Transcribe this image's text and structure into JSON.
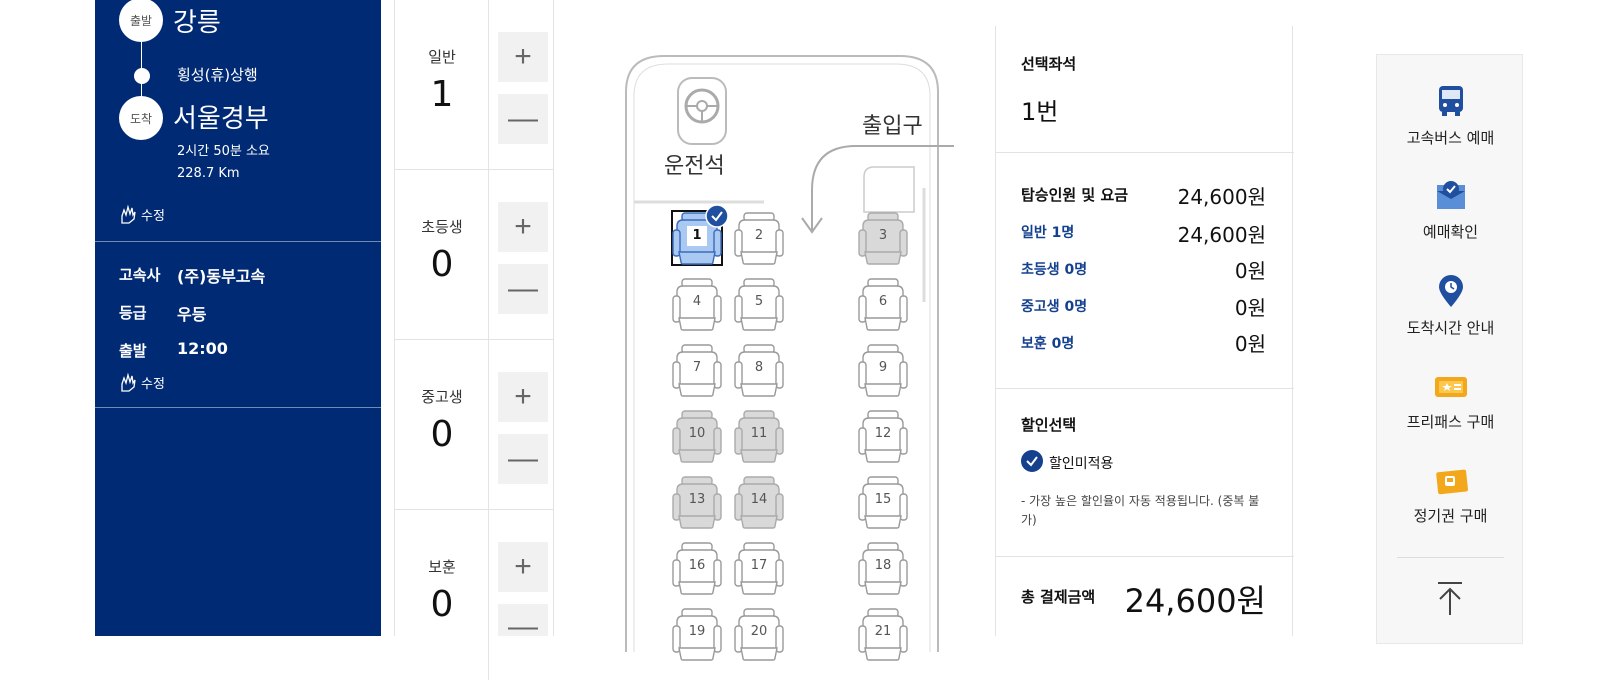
{
  "route": {
    "departure_badge": "출발",
    "departure_city": "강릉",
    "via": "횡성(휴)상행",
    "arrival_badge": "도착",
    "arrival_city": "서울경부",
    "duration": "2시간 50분 소요",
    "distance": "228.7 Km",
    "edit_label": "수정"
  },
  "bus_info": {
    "company_label": "고속사",
    "company_value": "(주)동부고속",
    "grade_label": "등급",
    "grade_value": "우등",
    "depart_label": "출발",
    "depart_value": "12:00",
    "edit_label": "수정"
  },
  "counters": [
    {
      "label": "일반",
      "value": "1"
    },
    {
      "label": "초등생",
      "value": "0"
    },
    {
      "label": "중고생",
      "value": "0"
    },
    {
      "label": "보훈",
      "value": "0"
    }
  ],
  "bus_layout": {
    "driver_label": "운전석",
    "entrance_label": "출입구",
    "selected_seat": 1,
    "seats": [
      {
        "num": "1",
        "state": "selected"
      },
      {
        "num": "2",
        "state": "available"
      },
      {
        "num": "3",
        "state": "taken"
      },
      {
        "num": "4",
        "state": "available"
      },
      {
        "num": "5",
        "state": "available"
      },
      {
        "num": "6",
        "state": "available"
      },
      {
        "num": "7",
        "state": "available"
      },
      {
        "num": "8",
        "state": "available"
      },
      {
        "num": "9",
        "state": "available"
      },
      {
        "num": "10",
        "state": "taken"
      },
      {
        "num": "11",
        "state": "taken"
      },
      {
        "num": "12",
        "state": "available"
      },
      {
        "num": "13",
        "state": "taken"
      },
      {
        "num": "14",
        "state": "taken"
      },
      {
        "num": "15",
        "state": "available"
      },
      {
        "num": "16",
        "state": "available"
      },
      {
        "num": "17",
        "state": "available"
      },
      {
        "num": "18",
        "state": "available"
      },
      {
        "num": "19",
        "state": "available"
      },
      {
        "num": "20",
        "state": "available"
      },
      {
        "num": "21",
        "state": "available"
      }
    ]
  },
  "summary": {
    "selected_seat_title": "선택좌석",
    "selected_seat_value": "1번",
    "fare_title": "탑승인원 및 요금",
    "fare_total": "24,600원",
    "rows": [
      {
        "label": "일반 1명",
        "value": "24,600원"
      },
      {
        "label": "초등생 0명",
        "value": "0원"
      },
      {
        "label": "중고생 0명",
        "value": "0원"
      },
      {
        "label": "보훈 0명",
        "value": "0원"
      }
    ],
    "discount_title": "할인선택",
    "discount_option": "할인미적용",
    "discount_note": "- 가장 높은 할인율이 자동 적용됩니다. (중복 불가)",
    "total_label": "총 결제금액",
    "total_value": "24,600원"
  },
  "quick_menu": [
    {
      "label": "고속버스 예매",
      "icon": "bus-icon"
    },
    {
      "label": "예매확인",
      "icon": "ticket-check-icon"
    },
    {
      "label": "도착시간 안내",
      "icon": "location-clock-icon"
    },
    {
      "label": "프리패스 구매",
      "icon": "freepass-icon"
    },
    {
      "label": "정기권 구매",
      "icon": "season-ticket-icon"
    }
  ],
  "colors": {
    "navy": "#012a75",
    "accent_blue": "#14408e",
    "selected_seat_fill": "#a9c8f2",
    "taken_seat_fill": "#d9d9d9"
  }
}
